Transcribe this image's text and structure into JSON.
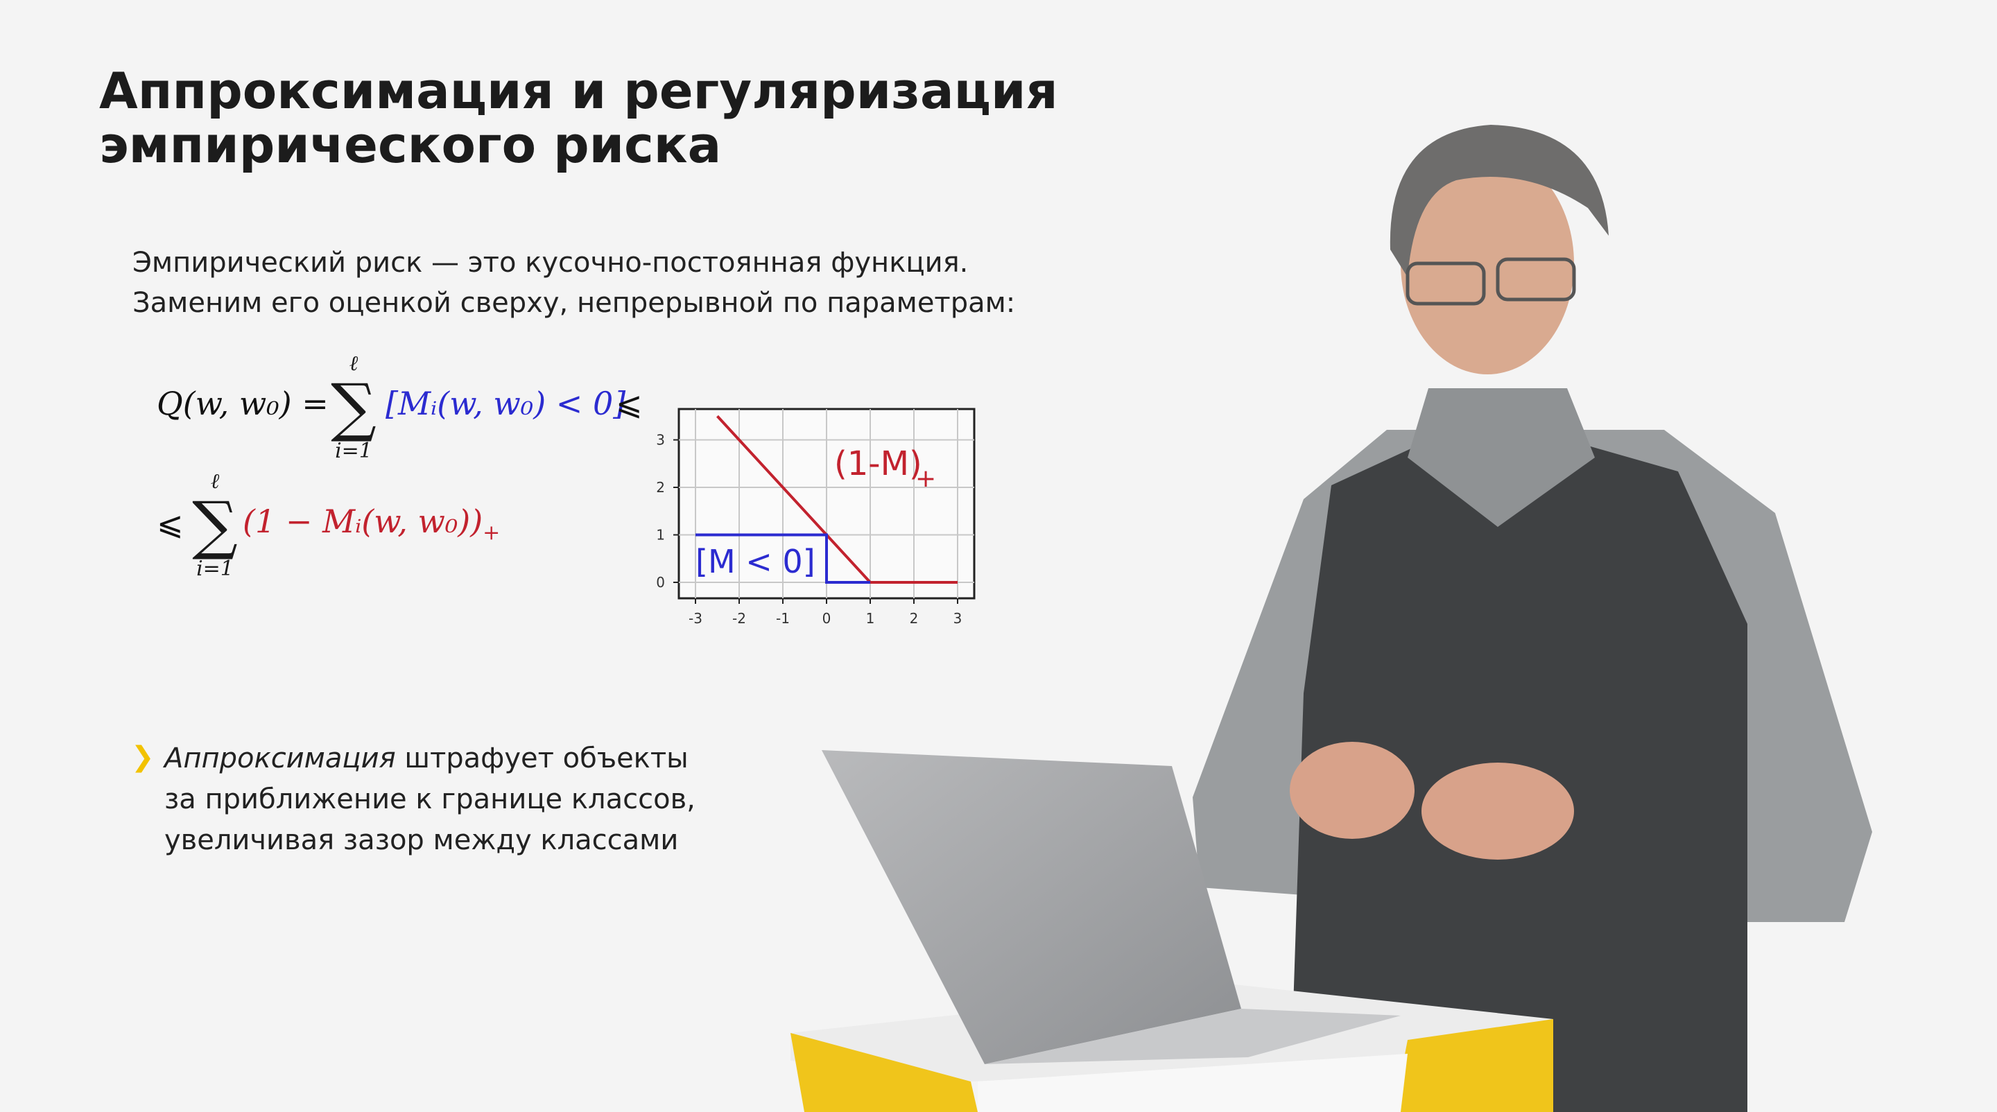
{
  "slide": {
    "title_line1": "Аппроксимация и регуляризация",
    "title_line2": "эмпирического риска",
    "body_line1": "Эмпирический риск — это кусочно-постоянная функция.",
    "body_line2": "Заменим его оценкой сверху, непрерывной по параметрам:",
    "formula": {
      "lhs": "Q(w, w₀) =",
      "sum_upper": "ℓ",
      "sum_lower": "i=1",
      "sum_sign": "∑",
      "indicator": "[Mᵢ(w, w₀) < 0]",
      "leq": "⩽",
      "hinge": "(1 − Mᵢ(w, w₀))",
      "hinge_sub": "+"
    },
    "bullet": {
      "emphasis": "Аппроксимация",
      "line1_rest": " штрафует объекты",
      "line2": "за приближение к границе классов,",
      "line3": "увеличивая зазор между классами"
    },
    "colors": {
      "accent": "#f2c200",
      "blue": "#2b2bd0",
      "red": "#c2222e"
    }
  },
  "chart_data": {
    "type": "line",
    "xlim": [
      -3.4,
      3.4
    ],
    "ylim": [
      -0.4,
      3.7
    ],
    "x_ticks": [
      "-3",
      "-2",
      "-1",
      "0",
      "1",
      "2",
      "3"
    ],
    "y_ticks": [
      "0",
      "1",
      "2",
      "3"
    ],
    "grid": true,
    "series": [
      {
        "name": "(1-M)+",
        "color": "#c2222e",
        "x": [
          -2.5,
          1,
          3
        ],
        "y": [
          3.5,
          0,
          0
        ]
      },
      {
        "name": "[M < 0]",
        "color": "#2b2bd0",
        "x": [
          -3,
          0,
          0,
          1
        ],
        "y": [
          1,
          1,
          0,
          0
        ]
      }
    ],
    "annotations": {
      "red_label": "(1-M)",
      "red_sub": "+",
      "blue_label": "[M < 0]"
    }
  }
}
